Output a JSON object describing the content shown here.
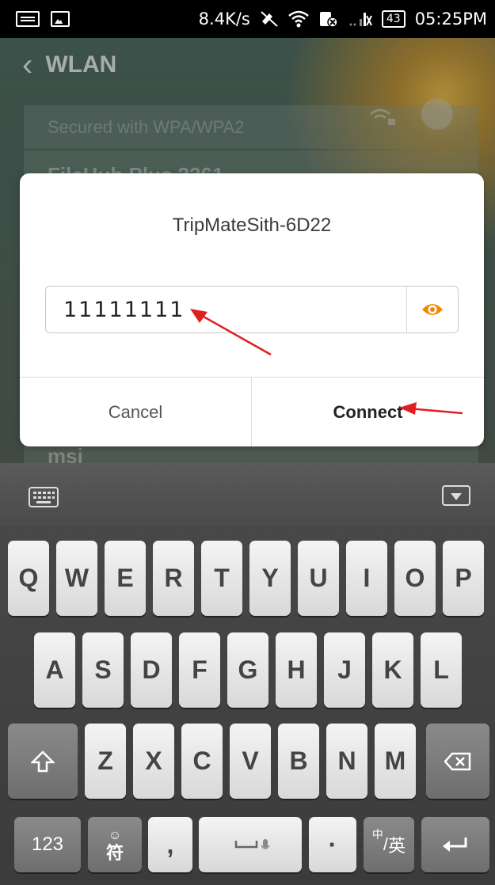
{
  "status_bar": {
    "speed": "8.4K/s",
    "battery": "43",
    "time": "05:25PM"
  },
  "header": {
    "title": "WLAN"
  },
  "background_list": {
    "row_secured": "Secured with WPA/WPA2",
    "row_partial": "FileHub Plus 3361",
    "row_msi": "msi"
  },
  "dialog": {
    "title": "TripMateSith-6D22",
    "password_value": "11111111",
    "cancel_label": "Cancel",
    "connect_label": "Connect"
  },
  "keyboard": {
    "row1": [
      "Q",
      "W",
      "E",
      "R",
      "T",
      "Y",
      "U",
      "I",
      "O",
      "P"
    ],
    "row2": [
      "A",
      "S",
      "D",
      "F",
      "G",
      "H",
      "J",
      "K",
      "L"
    ],
    "row3": [
      "Z",
      "X",
      "C",
      "V",
      "B",
      "N",
      "M"
    ],
    "num_key": "123",
    "sym_key": "符",
    "sym_top": "☺",
    "comma_key": ",",
    "period_key": "·",
    "lang_key_top": "中",
    "lang_key_bottom": "英",
    "lang_key_slash": "/"
  },
  "colors": {
    "eye_icon": "#f08a00",
    "arrow": "#e02020"
  }
}
